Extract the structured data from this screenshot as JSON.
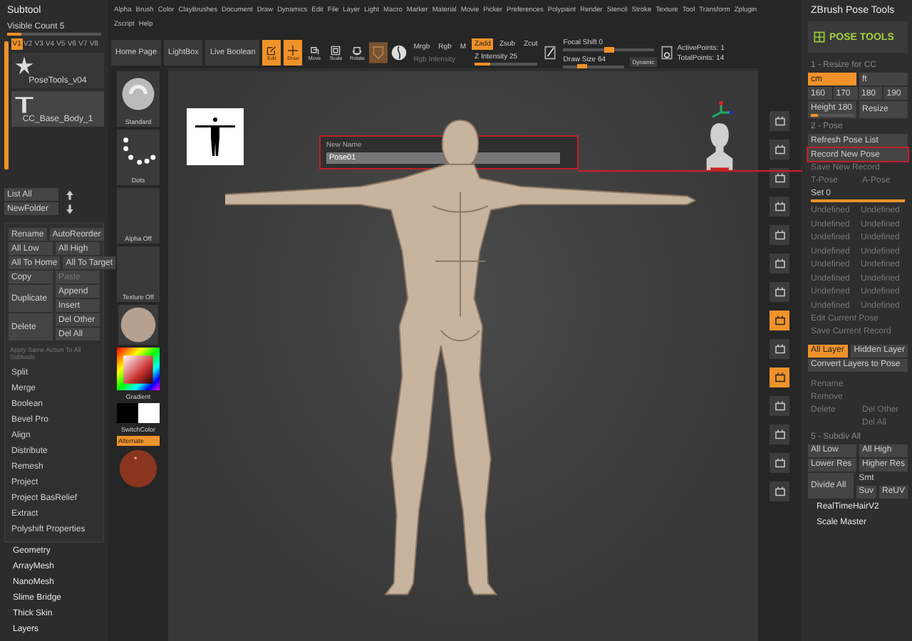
{
  "menu_rows": [
    [
      "Alpha",
      "Brush",
      "Color",
      "ClayBrushes",
      "Document",
      "Draw",
      "Dynamics",
      "Edit",
      "File",
      "Layer",
      "Light",
      "Macro",
      "Marker",
      "Material",
      "Movie",
      "Picker",
      "Preferences",
      "Polypaint",
      "Render",
      "Stencil",
      "Stroke",
      "Texture",
      "Tool",
      "Transform",
      "Zplugin"
    ],
    [
      "Zscript",
      "Help"
    ]
  ],
  "toolbar": {
    "pages": [
      "Home Page",
      "LightBox",
      "Live Boolean"
    ],
    "modes": [
      {
        "label": "Edit",
        "kind": "edit",
        "selected": true
      },
      {
        "label": "Draw",
        "kind": "draw",
        "selected": true
      },
      {
        "label": "Move",
        "kind": "move",
        "selected": false
      },
      {
        "label": "Scale",
        "kind": "scale",
        "selected": false
      },
      {
        "label": "Rotate",
        "kind": "rotate",
        "selected": false
      }
    ],
    "color_modes": [
      {
        "label": "Mrgb",
        "selected": false
      },
      {
        "label": "Rgb",
        "selected": false
      },
      {
        "label": "M",
        "selected": false
      }
    ],
    "rgb_intensity": "Rgb Intensity",
    "z_modes": [
      {
        "label": "Zadd",
        "selected": true
      },
      {
        "label": "Zsub",
        "selected": false
      },
      {
        "label": "Zcut",
        "selected": false
      }
    ],
    "z_intensity": {
      "label": "Z Intensity 25",
      "level": 0.25
    },
    "focal_shift": {
      "label": "Focal Shift 0",
      "level": 0.5
    },
    "draw_size": {
      "label": "Draw Size 64",
      "level": 0.3
    },
    "dynamic": "Dynamic",
    "points": [
      "ActivePoints: 1",
      "TotalPoints: 14"
    ]
  },
  "subtool": {
    "title": "Subtool",
    "visible_count": {
      "label": "Visible Count 5",
      "level": 0.15
    },
    "versions": [
      {
        "label": "V1",
        "selected": true
      },
      {
        "label": "V2",
        "selected": false
      },
      {
        "label": "V3",
        "selected": false
      },
      {
        "label": "V4",
        "selected": false
      },
      {
        "label": "V5",
        "selected": false
      },
      {
        "label": "V6",
        "selected": false
      },
      {
        "label": "V7",
        "selected": false
      },
      {
        "label": "V8",
        "selected": false
      }
    ],
    "items": [
      {
        "name": "PoseTools_v04",
        "kind": "star",
        "selected": false
      },
      {
        "name": "CC_Base_Body_1",
        "kind": "figure",
        "selected": true
      }
    ],
    "list_buttons": [
      "List All",
      "NewFolder"
    ],
    "actions": [
      {
        "kind": "pair",
        "buttons": [
          {
            "label": "Rename",
            "disabled": false
          },
          {
            "label": "AutoReorder",
            "disabled": false
          }
        ]
      },
      {
        "kind": "pair",
        "buttons": [
          {
            "label": "All Low",
            "disabled": false
          },
          {
            "label": "All High",
            "disabled": false
          }
        ]
      },
      {
        "kind": "pair",
        "buttons": [
          {
            "label": "All To Home",
            "disabled": false
          },
          {
            "label": "All To Target",
            "disabled": false
          }
        ]
      },
      {
        "kind": "pair",
        "buttons": [
          {
            "label": "Copy",
            "disabled": false
          },
          {
            "label": "Paste",
            "disabled": true
          }
        ]
      },
      {
        "kind": "stack",
        "buttons": [
          {
            "label": "Duplicate",
            "disabled": false
          },
          {
            "label": "Append",
            "disabled": false
          },
          {
            "label": "Insert",
            "disabled": false
          }
        ]
      },
      {
        "kind": "stack",
        "buttons": [
          {
            "label": "Delete",
            "disabled": false
          },
          {
            "label": "Del Other",
            "disabled": false
          },
          {
            "label": "Del All",
            "disabled": false
          }
        ]
      }
    ],
    "apply_all": "Apply Same Action To All Subtools",
    "extras": [
      "Split",
      "Merge",
      "Boolean",
      "Bevel Pro",
      "Align",
      "Distribute",
      "Remesh",
      "Project",
      "Project BasRelief",
      "Extract",
      "Polyshift Properties"
    ],
    "sections": [
      "Geometry",
      "ArrayMesh",
      "NanoMesh",
      "Slime Bridge",
      "Thick Skin",
      "Layers"
    ]
  },
  "tools": {
    "brush": "Standard",
    "stroke": "Dots",
    "alpha": "Alpha Off",
    "texture": "Texture Off",
    "gradient": "Gradient",
    "switch_color": "SwitchColor",
    "alternate": {
      "label": "Alternate",
      "selected": true
    }
  },
  "canvas": {
    "dialog": {
      "title": "New Name",
      "value": "Pose01"
    }
  },
  "dock": [
    {
      "active": false
    },
    {
      "active": false
    },
    {
      "active": false
    },
    {
      "active": false
    },
    {
      "active": false
    },
    {
      "active": false
    },
    {
      "active": false
    },
    {
      "active": true
    },
    {
      "active": false
    },
    {
      "active": true
    },
    {
      "active": false
    },
    {
      "active": false
    },
    {
      "active": false
    },
    {
      "active": false
    }
  ],
  "pose_tools": {
    "title": "ZBrush Pose Tools",
    "logo": "POSE TOOLS",
    "resize_heading": "1 - Resize for CC",
    "units": [
      {
        "label": "cm",
        "selected": true
      },
      {
        "label": "ft",
        "selected": false
      }
    ],
    "heights": [
      "160",
      "170",
      "180",
      "190"
    ],
    "height_slider": {
      "label": "Height 180",
      "level": 0.15
    },
    "resize": "Resize",
    "pose_heading": "2 - Pose",
    "refresh": "Refresh Pose List",
    "record": "Record New Pose",
    "save_record": "Save New Record",
    "pose_names": [
      "T-Pose",
      "A-Pose"
    ],
    "set_slider": {
      "label": "Set 0",
      "level": 1
    },
    "slots": [
      "Undefined",
      "Undefined",
      "Undefined",
      "Undefined",
      "Undefined",
      "Undefined",
      "Undefined",
      "Undefined",
      "Undefined",
      "Undefined",
      "Undefined",
      "Undefined",
      "Undefined",
      "Undefined",
      "Undefined",
      "Undefined"
    ],
    "edit_pose": "Edit Current Pose",
    "save_current": "Save Current Record",
    "layer_modes": [
      {
        "label": "All Layer",
        "selected": true
      },
      {
        "label": "Hidden Layer",
        "selected": false
      }
    ],
    "convert": "Convert Layers to Pose",
    "manage": {
      "rename": "Rename",
      "remove": "Remove",
      "delete": "Delete",
      "del_other": "Del Other",
      "del_all": "Del All"
    },
    "subdiv_heading": "5 - Subdiv All",
    "subdiv_pairs": [
      [
        "All Low",
        "All High"
      ],
      [
        "Lower Res",
        "Higher Res"
      ]
    ],
    "divide": "Divide All",
    "smt": "Smt",
    "suv": "Suv",
    "reuv": "ReUV",
    "plugins": [
      "RealTimeHairV2",
      "Scale Master"
    ]
  }
}
